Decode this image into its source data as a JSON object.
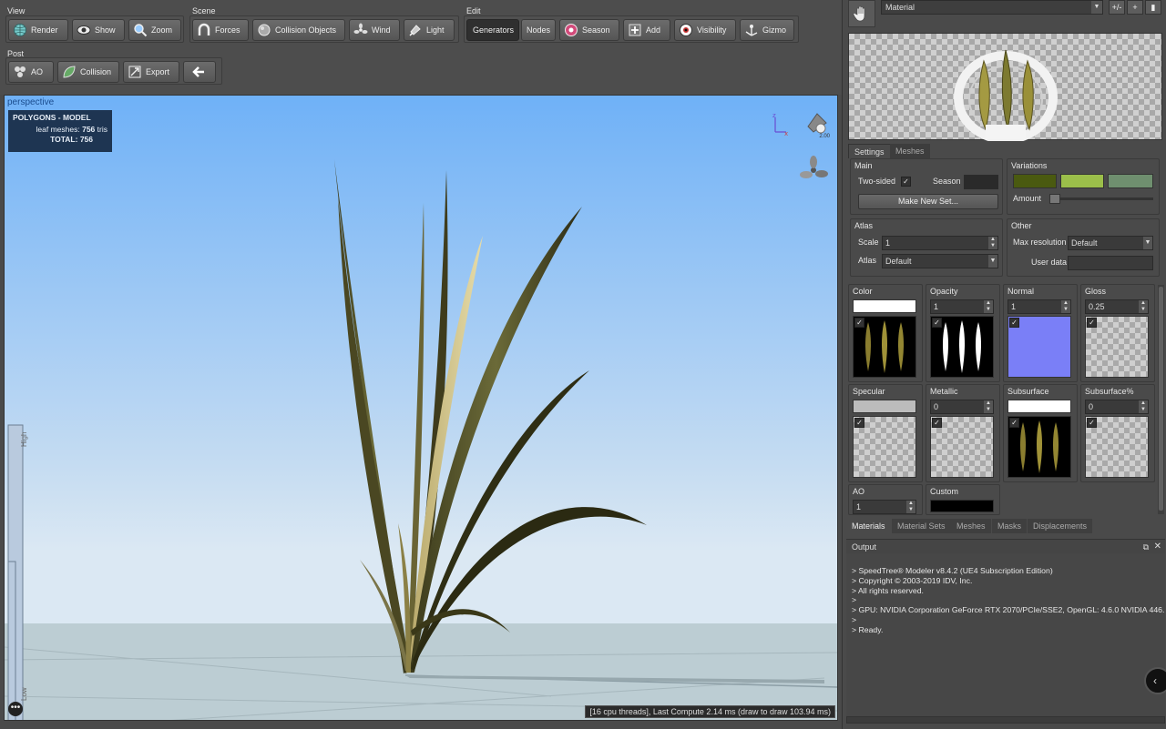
{
  "toolbar": {
    "view": {
      "label": "View",
      "buttons": [
        "Render",
        "Show",
        "Zoom"
      ]
    },
    "scene": {
      "label": "Scene",
      "buttons": [
        "Forces",
        "Collision Objects",
        "Wind",
        "Light"
      ]
    },
    "edit": {
      "label": "Edit",
      "buttons": [
        "Generators",
        "Nodes",
        "Season",
        "Add",
        "Visibility",
        "Gizmo"
      ],
      "active": "Generators"
    },
    "post": {
      "label": "Post",
      "buttons": [
        "AO",
        "Collision",
        "Export"
      ]
    }
  },
  "viewport": {
    "camera_label": "perspective",
    "polygons": {
      "title": "POLYGONS - MODEL",
      "leaf_label": "leaf meshes:",
      "leaf_value": "756",
      "leaf_unit": "tris",
      "total_label": "TOTAL:",
      "total_value": "756"
    },
    "light_value": "2.00",
    "high_label": "High",
    "low_label": "Low",
    "status": "[16 cpu threads], Last Compute 2.14 ms (draw to draw 103.94 ms)"
  },
  "right_panel": {
    "material_select": "Material",
    "header_buttons": [
      "+/-",
      "+",
      "copy"
    ],
    "tabs": [
      "Settings",
      "Meshes"
    ],
    "main": {
      "label": "Main",
      "two_sided_label": "Two-sided",
      "season_label": "Season",
      "make_new_set": "Make New Set..."
    },
    "variations": {
      "label": "Variations",
      "amount_label": "Amount",
      "colors": [
        "#4a5a10",
        "#9bbf4a",
        "#6f8f6f"
      ]
    },
    "atlas": {
      "label": "Atlas",
      "scale_label": "Scale",
      "scale_value": "1",
      "atlas_label": "Atlas",
      "atlas_value": "Default"
    },
    "other": {
      "label": "Other",
      "max_res_label": "Max resolution",
      "max_res_value": "Default",
      "user_data_label": "User data",
      "user_data_value": ""
    },
    "channels": {
      "color": {
        "label": "Color"
      },
      "opacity": {
        "label": "Opacity",
        "value": "1"
      },
      "normal": {
        "label": "Normal",
        "value": "1"
      },
      "gloss": {
        "label": "Gloss",
        "value": "0.25"
      },
      "specular": {
        "label": "Specular"
      },
      "metallic": {
        "label": "Metallic",
        "value": "0"
      },
      "subsurface": {
        "label": "Subsurface"
      },
      "subsurface_pct": {
        "label": "Subsurface%",
        "value": "0"
      },
      "ao": {
        "label": "AO",
        "value": "1"
      },
      "custom": {
        "label": "Custom"
      }
    },
    "bottom_tabs": [
      "Materials",
      "Material Sets",
      "Meshes",
      "Masks",
      "Displacements"
    ],
    "output": {
      "title": "Output",
      "lines": [
        "> SpeedTree® Modeler v8.4.2 (UE4 Subscription Edition)",
        "> Copyright © 2003-2019 IDV, Inc.",
        "> All rights reserved.",
        ">",
        "> GPU: NVIDIA Corporation GeForce RTX 2070/PCIe/SSE2, OpenGL: 4.6.0 NVIDIA 446.",
        ">",
        "> Ready."
      ]
    }
  }
}
